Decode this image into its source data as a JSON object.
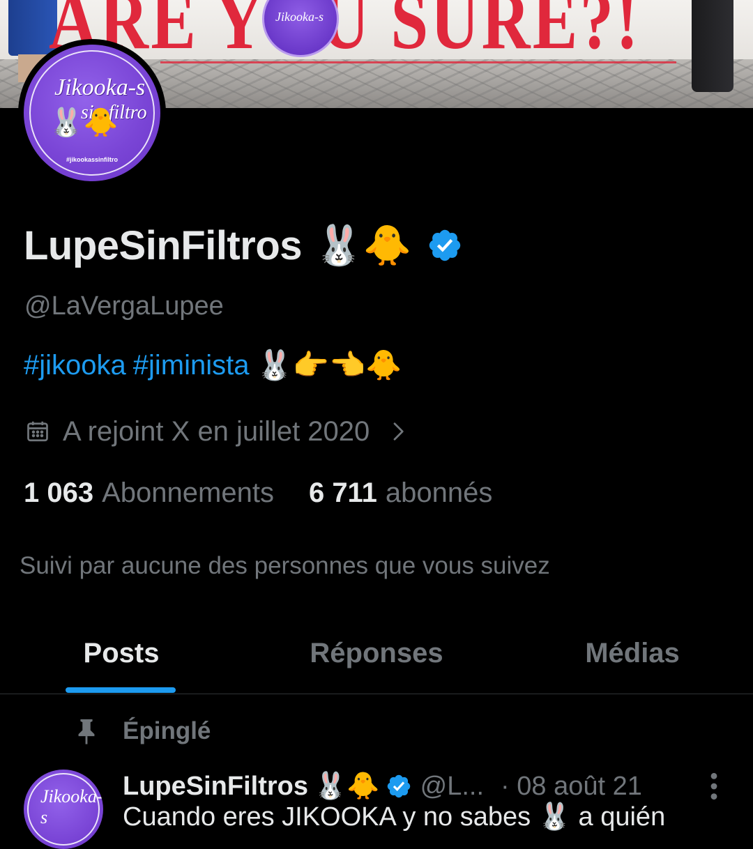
{
  "banner": {
    "text": "ARE YOU SURE?!"
  },
  "avatar": {
    "script_line1": "Jikooka-s",
    "script_line2": "sin filtro",
    "tag": "#jikookassinfiltro",
    "emoji": "🐰🐥"
  },
  "profile": {
    "display_name": "LupeSinFiltros",
    "name_emojis": "🐰🐥",
    "handle": "@LaVergaLupee",
    "bio": {
      "hashtag1": "#jikooka",
      "hashtag2": "#jiminista",
      "emojis": "🐰👉👈🐥"
    },
    "joined": "A rejoint X en juillet 2020",
    "following_count": "1 063",
    "following_label": "Abonnements",
    "followers_count": "6 711",
    "followers_label": "abonnés",
    "followed_by": "Suivi par aucune des personnes que vous suivez"
  },
  "tabs": [
    {
      "label": "Posts",
      "active": true
    },
    {
      "label": "Réponses",
      "active": false
    },
    {
      "label": "Médias",
      "active": false
    }
  ],
  "pinned": {
    "label": "Épinglé"
  },
  "post": {
    "name": "LupeSinFiltros",
    "emojis": "🐰🐥",
    "handle": "@L...",
    "date": "· 08 août 21",
    "text": "Cuando eres JIKOOKA y no sabes 🐰 a quién"
  },
  "colors": {
    "accent": "#1d9bf0",
    "muted": "#71767b",
    "text": "#e7e9ea",
    "background": "#000000",
    "avatar_purple": "#7a45d6",
    "banner_red": "#e0283c"
  },
  "icons": [
    "calendar-icon",
    "chevron-right-icon",
    "verified-badge-icon",
    "pin-icon",
    "more-vertical-icon"
  ]
}
